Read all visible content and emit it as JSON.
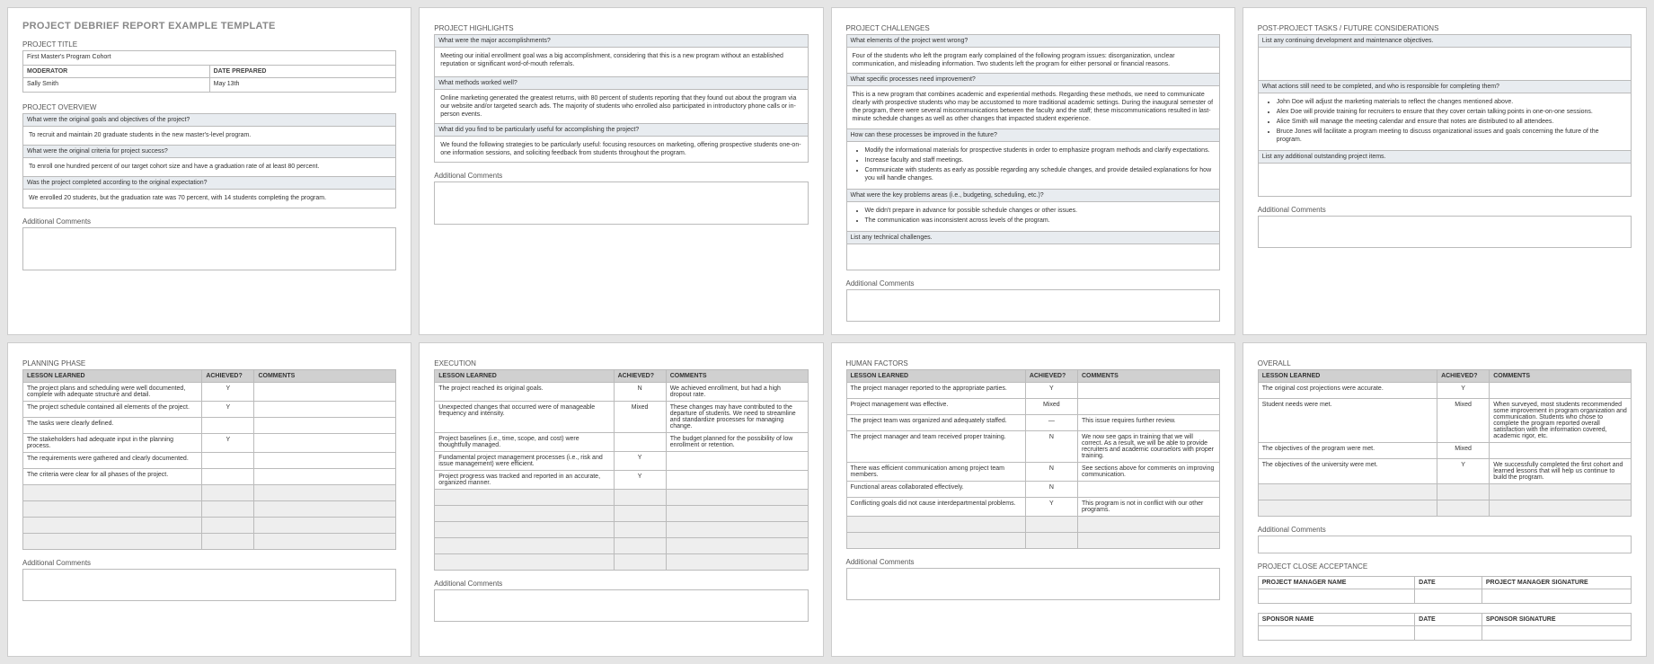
{
  "doc_title": "PROJECT DEBRIEF REPORT EXAMPLE TEMPLATE",
  "meta": {
    "project_title_label": "PROJECT TITLE",
    "project_title_value": "First Master's Program Cohort",
    "moderator_label": "MODERATOR",
    "moderator_value": "Sally Smith",
    "date_label": "DATE PREPARED",
    "date_value": "May 13th"
  },
  "overview": {
    "heading": "PROJECT OVERVIEW",
    "q1": "What were the original goals and objectives of the project?",
    "a1": "To recruit and maintain 20 graduate students in the new master's-level program.",
    "q2": "What were the original criteria for project success?",
    "a2": "To enroll one hundred percent of our target cohort size and have a graduation rate of at least 80 percent.",
    "q3": "Was the project completed according to the original expectation?",
    "a3": "We enrolled 20 students, but the graduation rate was 70 percent, with 14 students completing the program.",
    "addl_label": "Additional Comments"
  },
  "highlights": {
    "heading": "PROJECT HIGHLIGHTS",
    "q1": "What were the major accomplishments?",
    "a1": "Meeting our initial enrollment goal was a big accomplishment, considering that this is a new program without an established reputation or significant word-of-mouth referrals.",
    "q2": "What methods worked well?",
    "a2": "Online marketing generated the greatest returns, with 80 percent of students reporting that they found out about the program via our website and/or targeted search ads. The majority of students who enrolled also participated in introductory phone calls or in-person events.",
    "q3": "What did you find to be particularly useful for accomplishing the project?",
    "a3": "We found the following strategies to be particularly useful: focusing resources on marketing, offering prospective students one-on-one information sessions, and soliciting feedback from students throughout the program.",
    "addl_label": "Additional Comments"
  },
  "challenges": {
    "heading": "PROJECT CHALLENGES",
    "q1": "What elements of the project went wrong?",
    "a1": "Four of the students who left the program early complained of the following program issues: disorganization, unclear communication, and misleading information. Two students left the program for either personal or financial reasons.",
    "q2": "What specific processes need improvement?",
    "a2": "This is a new program that combines academic and experiential methods. Regarding these methods, we need to communicate clearly with prospective students who may be accustomed to more traditional academic settings. During the inaugural semester of the program, there were several miscommunications between the faculty and the staff; these miscommunications resulted in last-minute schedule changes as well as other changes that impacted student experience.",
    "q3": "How can these processes be improved in the future?",
    "a3_items": [
      "Modify the informational materials for prospective students in order to emphasize program methods and clarify expectations.",
      "Increase faculty and staff meetings.",
      "Communicate with students as early as possible regarding any schedule changes, and provide detailed explanations for how you will handle changes."
    ],
    "q4": "What were the key problems areas (i.e., budgeting, scheduling, etc.)?",
    "a4_items": [
      "We didn't prepare in advance for possible schedule changes or other issues.",
      "The communication was inconsistent across levels of the program."
    ],
    "q5": "List any technical challenges.",
    "addl_label": "Additional Comments"
  },
  "postproject": {
    "heading": "POST-PROJECT TASKS / FUTURE CONSIDERATIONS",
    "q1": "List any continuing development and maintenance objectives.",
    "q2": "What actions still need to be completed, and who is responsible for completing them?",
    "a2_items": [
      "John Doe will adjust the marketing materials to reflect the changes mentioned above.",
      "Alex Doe will provide training for recruiters to ensure that they cover certain talking points in one-on-one sessions.",
      "Alice Smith will manage the meeting calendar and ensure that notes are distributed to all attendees.",
      "Bruce Jones will facilitate a program meeting to discuss organizational issues and goals concerning the future of the program."
    ],
    "q3": "List any additional outstanding project items.",
    "addl_label": "Additional Comments"
  },
  "planning": {
    "heading": "PLANNING PHASE",
    "cols": {
      "lesson": "LESSON LEARNED",
      "ach": "ACHIEVED?",
      "comments": "COMMENTS"
    },
    "rows": [
      {
        "lesson": "The project plans and scheduling were well documented, complete with adequate structure and detail.",
        "ach": "Y",
        "comments": ""
      },
      {
        "lesson": "The project schedule contained all elements of the project.",
        "ach": "Y",
        "comments": ""
      },
      {
        "lesson": "The tasks were clearly defined.",
        "ach": "",
        "comments": ""
      },
      {
        "lesson": "The stakeholders had adequate input in the planning process.",
        "ach": "Y",
        "comments": ""
      },
      {
        "lesson": "The requirements were gathered and clearly documented.",
        "ach": "",
        "comments": ""
      },
      {
        "lesson": "The criteria were clear for all phases of the project.",
        "ach": "",
        "comments": ""
      }
    ],
    "addl_label": "Additional Comments"
  },
  "execution": {
    "heading": "EXECUTION",
    "cols": {
      "lesson": "LESSON LEARNED",
      "ach": "ACHIEVED?",
      "comments": "COMMENTS"
    },
    "rows": [
      {
        "lesson": "The project reached its original goals.",
        "ach": "N",
        "comments": "We achieved enrollment, but had a high dropout rate."
      },
      {
        "lesson": "Unexpected changes that occurred were of manageable frequency and intensity.",
        "ach": "Mixed",
        "comments": "These changes may have contributed to the departure of students. We need to streamline and standardize processes for managing change."
      },
      {
        "lesson": "Project baselines (i.e., time, scope, and cost) were thoughtfully managed.",
        "ach": "",
        "comments": "The budget planned for the possibility of low enrollment or retention."
      },
      {
        "lesson": "Fundamental project management processes (i.e., risk and issue management) were efficient.",
        "ach": "Y",
        "comments": ""
      },
      {
        "lesson": "Project progress was tracked and reported in an accurate, organized manner.",
        "ach": "Y",
        "comments": ""
      }
    ],
    "addl_label": "Additional Comments"
  },
  "human": {
    "heading": "HUMAN FACTORS",
    "cols": {
      "lesson": "LESSON LEARNED",
      "ach": "ACHIEVED?",
      "comments": "COMMENTS"
    },
    "rows": [
      {
        "lesson": "The project manager reported to the appropriate parties.",
        "ach": "Y",
        "comments": ""
      },
      {
        "lesson": "Project management was effective.",
        "ach": "Mixed",
        "comments": ""
      },
      {
        "lesson": "The project team was organized and adequately staffed.",
        "ach": "—",
        "comments": "This issue requires further review."
      },
      {
        "lesson": "The project manager and team received proper training.",
        "ach": "N",
        "comments": "We now see gaps in training that we will correct. As a result, we will be able to provide recruiters and academic counselors with proper training."
      },
      {
        "lesson": "There was efficient communication among project team members.",
        "ach": "N",
        "comments": "See sections above for comments on improving communication."
      },
      {
        "lesson": "Functional areas collaborated effectively.",
        "ach": "N",
        "comments": ""
      },
      {
        "lesson": "Conflicting goals did not cause interdepartmental problems.",
        "ach": "Y",
        "comments": "This program is not in conflict with our other programs."
      }
    ],
    "addl_label": "Additional Comments"
  },
  "overall": {
    "heading": "OVERALL",
    "cols": {
      "lesson": "LESSON LEARNED",
      "ach": "ACHIEVED?",
      "comments": "COMMENTS"
    },
    "rows": [
      {
        "lesson": "The original cost projections were accurate.",
        "ach": "Y",
        "comments": ""
      },
      {
        "lesson": "Student needs were met.",
        "ach": "Mixed",
        "comments": "When surveyed, most students recommended some improvement in program organization and communication. Students who chose to complete the program reported overall satisfaction with the information covered, academic rigor, etc."
      },
      {
        "lesson": "The objectives of the program were met.",
        "ach": "Mixed",
        "comments": ""
      },
      {
        "lesson": "The objectives of the university were met.",
        "ach": "Y",
        "comments": "We successfully completed the first cohort and learned lessons that will help us continue to build the program."
      }
    ],
    "addl_label": "Additional Comments",
    "close_heading": "PROJECT CLOSE ACCEPTANCE",
    "pm_name_label": "PROJECT MANAGER NAME",
    "date_label": "DATE",
    "pm_sig_label": "PROJECT MANAGER SIGNATURE",
    "sponsor_name_label": "SPONSOR NAME",
    "sponsor_sig_label": "SPONSOR SIGNATURE"
  }
}
